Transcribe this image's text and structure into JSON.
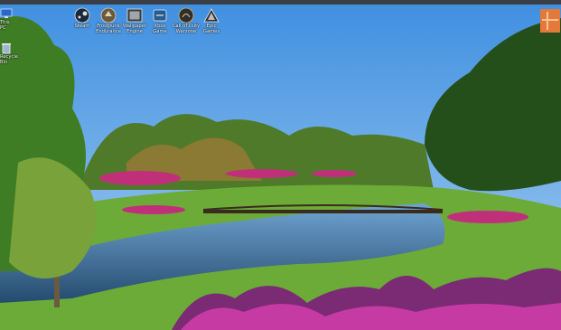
{
  "desktop": {
    "left_icons": [
      {
        "name": "icon-this-pc",
        "label": "This PC",
        "glyph": "monitor-icon"
      },
      {
        "name": "icon-recycle-bin",
        "label": "Recycle Bin",
        "glyph": "recycle-bin-icon"
      }
    ],
    "top_icons": [
      {
        "name": "icon-steam",
        "label": "Steam",
        "glyph": "steam-icon"
      },
      {
        "name": "icon-game-2",
        "label": "Frostpunk\nEndurance",
        "glyph": "game-icon"
      },
      {
        "name": "icon-game-3",
        "label": "Wallpaper\nEngine",
        "glyph": "game-icon"
      },
      {
        "name": "icon-game-4",
        "label": "Xbox\nGame",
        "glyph": "game-icon"
      },
      {
        "name": "icon-game-5",
        "label": "Call of Duty\nWarzone",
        "glyph": "game-icon"
      },
      {
        "name": "icon-game-6",
        "label": "Epic\nGames",
        "glyph": "game-icon"
      }
    ],
    "colors": {
      "sky": "#5fa6e8",
      "grass": "#4e9a2c",
      "water": "#2f5f8f",
      "flowers": "#c0307a",
      "tray_accent": "#e5793a"
    }
  }
}
